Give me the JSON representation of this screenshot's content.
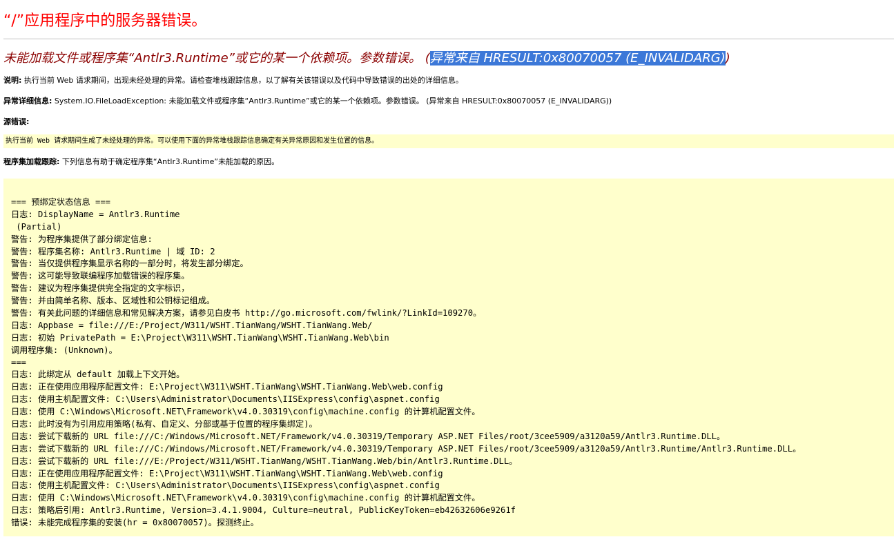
{
  "page": {
    "title": "“/”应用程序中的服务器错误。",
    "subtitle_prefix": "未能加载文件或程序集“Antlr3.Runtime”或它的某一个依赖项。参数错误。 (",
    "subtitle_selected": "异常来自 HRESULT:0x80070057 (E_INVALIDARG)",
    "subtitle_suffix": ")"
  },
  "description": {
    "label": "说明:",
    "text": " 执行当前 Web 请求期间，出现未经处理的异常。请检查堆栈跟踪信息，以了解有关该错误以及代码中导致错误的出处的详细信息。"
  },
  "exception_details": {
    "label": "异常详细信息:",
    "text": " System.IO.FileLoadException: 未能加载文件或程序集“Antlr3.Runtime”或它的某一个依赖项。参数错误。 (异常来自 HRESULT:0x80070057 (E_INVALIDARG))"
  },
  "source_error": {
    "label": "源错误:",
    "text": "执行当前 Web 请求期间生成了未经处理的异常。可以使用下面的异常堆栈跟踪信息确定有关异常原因和发生位置的信息。"
  },
  "assembly_trace": {
    "label": "程序集加载跟踪:",
    "text": " 下列信息有助于确定程序集“Antlr3.Runtime”未能加载的原因。"
  },
  "log_lines": [
    "=== 预绑定状态信息 ===",
    "日志: DisplayName = Antlr3.Runtime",
    " (Partial)",
    "警告: 为程序集提供了部分绑定信息:",
    "警告: 程序集名称: Antlr3.Runtime | 域 ID: 2",
    "警告: 当仅提供程序集显示名称的一部分时，将发生部分绑定。",
    "警告: 这可能导致联编程序加载错误的程序集。",
    "警告: 建议为程序集提供完全指定的文字标识，",
    "警告: 并由简单名称、版本、区域性和公钥标记组成。",
    "警告: 有关此问题的详细信息和常见解决方案，请参见白皮书 http://go.microsoft.com/fwlink/?LinkId=109270。",
    "日志: Appbase = file:///E:/Project/W311/WSHT.TianWang/WSHT.TianWang.Web/",
    "日志: 初始 PrivatePath = E:\\Project\\W311\\WSHT.TianWang\\WSHT.TianWang.Web\\bin",
    "调用程序集: (Unknown)。",
    "===",
    "日志: 此绑定从 default 加载上下文开始。",
    "日志: 正在使用应用程序配置文件: E:\\Project\\W311\\WSHT.TianWang\\WSHT.TianWang.Web\\web.config",
    "日志: 使用主机配置文件: C:\\Users\\Administrator\\Documents\\IISExpress\\config\\aspnet.config",
    "日志: 使用 C:\\Windows\\Microsoft.NET\\Framework\\v4.0.30319\\config\\machine.config 的计算机配置文件。",
    "日志: 此时没有为引用应用策略(私有、自定义、分部或基于位置的程序集绑定)。",
    "日志: 尝试下载新的 URL file:///C:/Windows/Microsoft.NET/Framework/v4.0.30319/Temporary ASP.NET Files/root/3cee5909/a3120a59/Antlr3.Runtime.DLL。",
    "日志: 尝试下载新的 URL file:///C:/Windows/Microsoft.NET/Framework/v4.0.30319/Temporary ASP.NET Files/root/3cee5909/a3120a59/Antlr3.Runtime/Antlr3.Runtime.DLL。",
    "日志: 尝试下载新的 URL file:///E:/Project/W311/WSHT.TianWang/WSHT.TianWang.Web/bin/Antlr3.Runtime.DLL。",
    "日志: 正在使用应用程序配置文件: E:\\Project\\W311\\WSHT.TianWang\\WSHT.TianWang.Web\\web.config",
    "日志: 使用主机配置文件: C:\\Users\\Administrator\\Documents\\IISExpress\\config\\aspnet.config",
    "日志: 使用 C:\\Windows\\Microsoft.NET\\Framework\\v4.0.30319\\config\\machine.config 的计算机配置文件。",
    "日志: 策略后引用: Antlr3.Runtime, Version=3.4.1.9004, Culture=neutral, PublicKeyToken=eb42632606e9261f",
    "错误: 未能完成程序集的安装(hr = 0x80070057)。探测终止。"
  ]
}
